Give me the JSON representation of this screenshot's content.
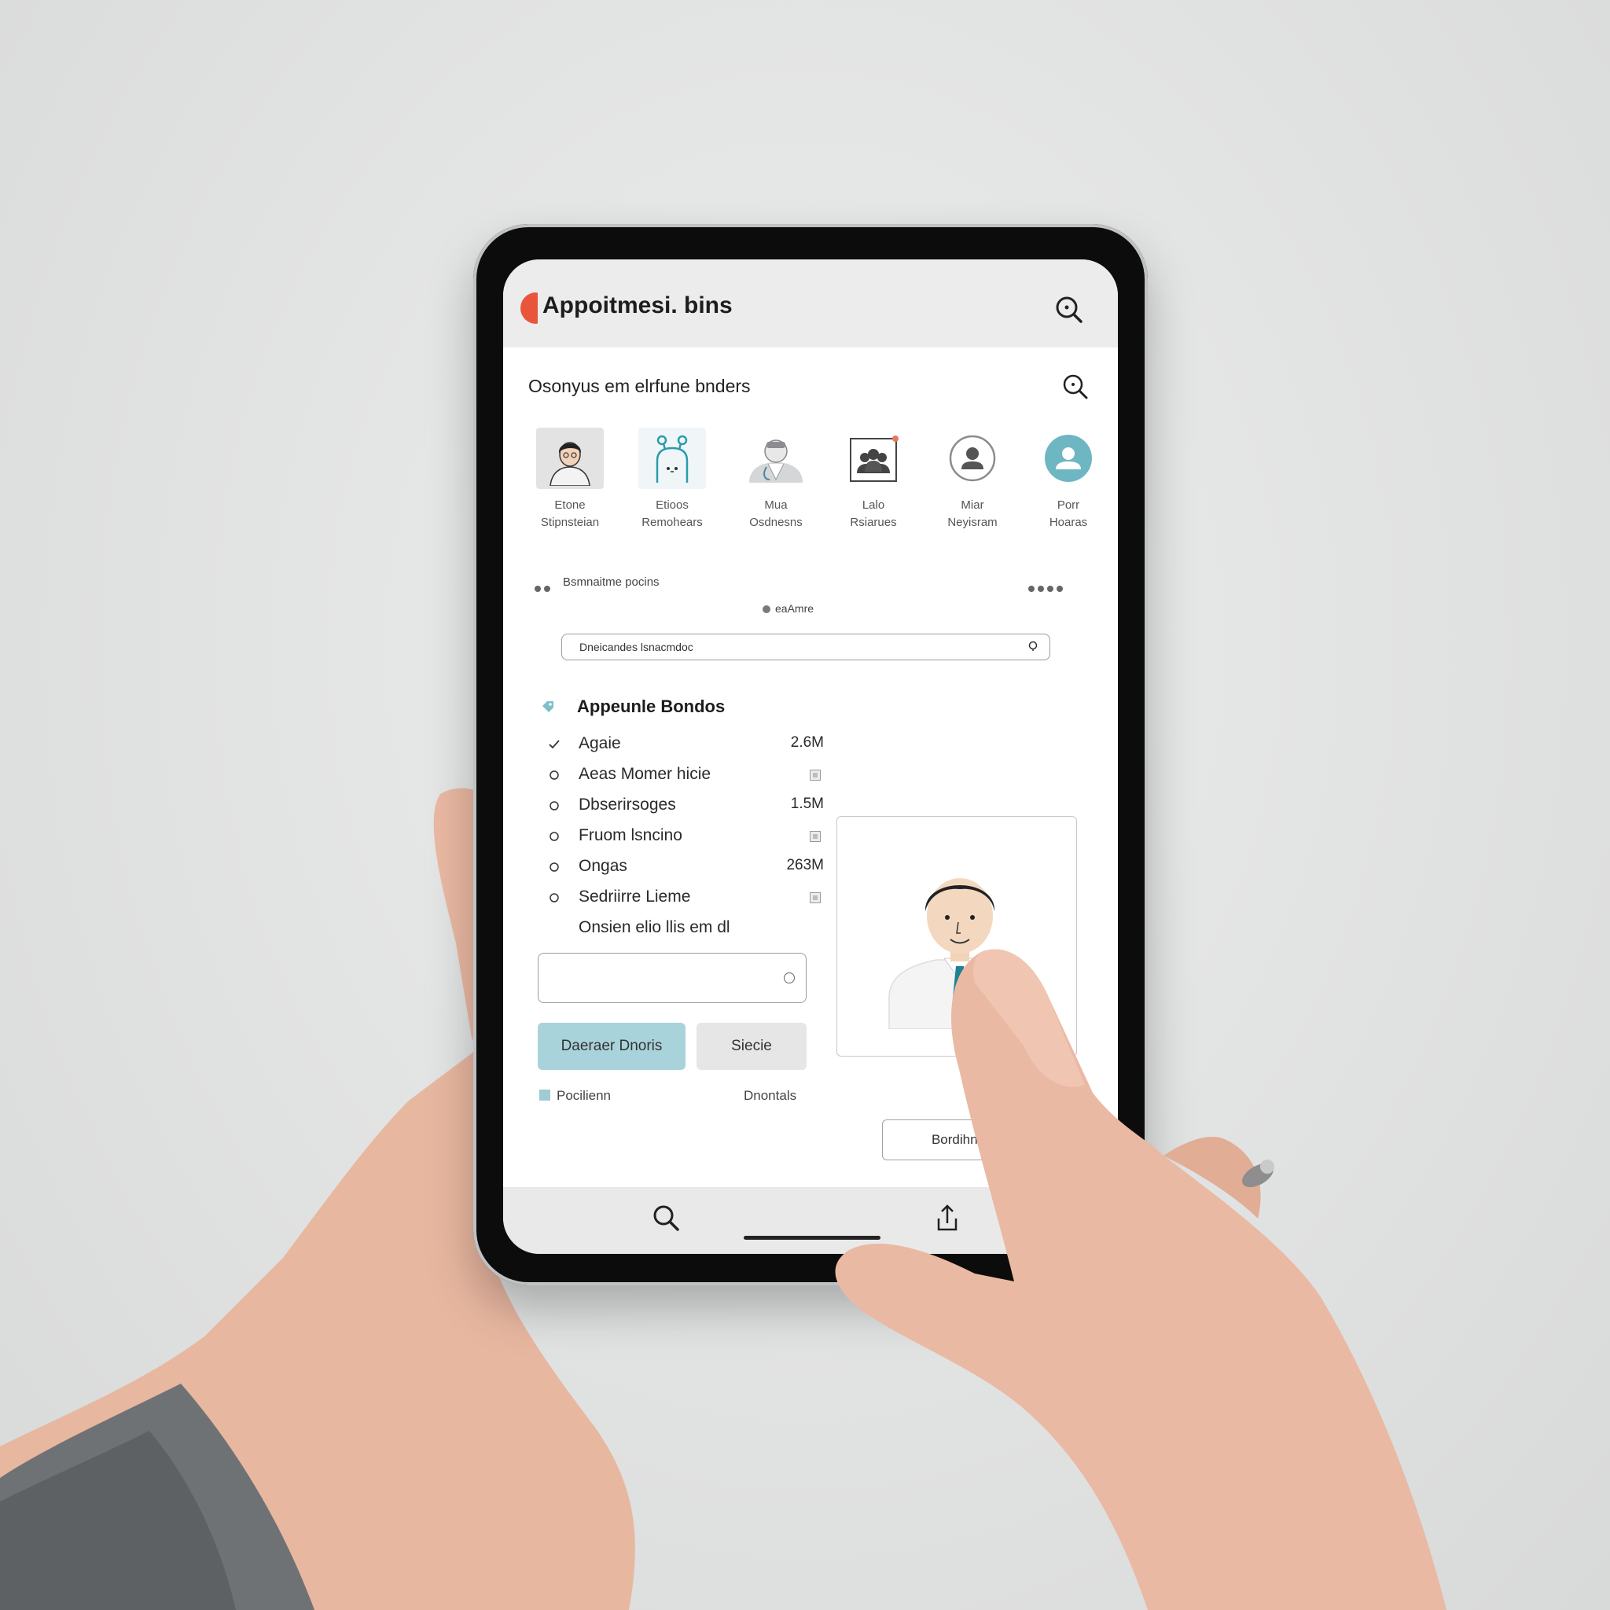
{
  "app": {
    "title": "Appoitmesi. bins",
    "accent_color": "#e9553b",
    "icon": "search-icon"
  },
  "section": {
    "title": "Osonyus em elrfune bnders",
    "icon": "search-icon"
  },
  "categories": [
    {
      "label": "Etone\nStipnsteian",
      "icon": "woman-avatar-icon"
    },
    {
      "label": "Etioos\nRemohears",
      "icon": "robot-icon"
    },
    {
      "label": "Mua\nOsdnesns",
      "icon": "doctor-icon"
    },
    {
      "label": "Lalo\nRsiarues",
      "icon": "group-icon"
    },
    {
      "label": "Miar\nNeyisram",
      "icon": "person-circle-icon"
    },
    {
      "label": "Porr\nHoaras",
      "icon": "support-icon"
    }
  ],
  "filter": {
    "label": "Bsmnaitme pocins",
    "online_label": "eaAmre",
    "more_icon": "more-dots-icon"
  },
  "search_field": {
    "value": "Dneicandes lsnacmdoc",
    "icon": "location-pin-icon"
  },
  "list": {
    "header": "Appeunle Bondos",
    "header_icon": "tag-icon",
    "rows": [
      {
        "label": "Agaie",
        "value": "2.6M",
        "marker": "check"
      },
      {
        "label": "Aeas Momer hicie",
        "value": "",
        "marker": "circle"
      },
      {
        "label": "Dbserirsoges",
        "value": "1.5M",
        "marker": "circle"
      },
      {
        "label": "Fruom lsncino",
        "value": "",
        "marker": "circle"
      },
      {
        "label": "Ongas",
        "value": "263M",
        "marker": "circle"
      },
      {
        "label": "Sedriirre Lieme",
        "value": "",
        "marker": "circle"
      },
      {
        "label": "Onsien elio llis em dl",
        "value": "",
        "marker": "none"
      }
    ]
  },
  "buttons": {
    "primary": "Daeraer Dnoris",
    "secondary": "Siecie",
    "outline": "Bordihne"
  },
  "footer": {
    "left": "Pocilienn",
    "right": "Dnontals"
  },
  "colors": {
    "primary_button": "#a9d3da",
    "teal_accent": "#6fb6c3"
  }
}
